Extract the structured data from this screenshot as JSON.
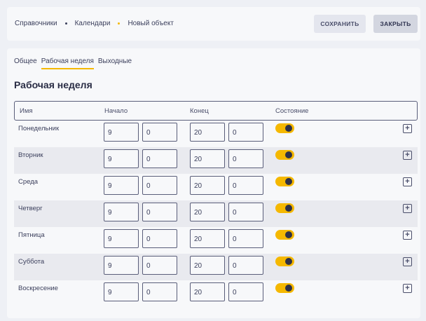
{
  "breadcrumb": {
    "items": [
      "Справочники",
      "Календари",
      "Новый объект"
    ],
    "sep_colors": [
      "#3b3f5c",
      "#f5b800"
    ]
  },
  "toolbar": {
    "save_label": "СОХРАНИТЬ",
    "close_label": "ЗАКРЫТЬ"
  },
  "tabs": [
    {
      "label": "Общее"
    },
    {
      "label": "Рабочая неделя",
      "active": true
    },
    {
      "label": "Выходные"
    }
  ],
  "section_title": "Рабочая неделя",
  "table": {
    "headers": [
      "Имя",
      "Начало",
      "Конец",
      "Состояние"
    ],
    "rows": [
      {
        "name": "Понедельник",
        "start_h": "9",
        "start_m": "0",
        "end_h": "20",
        "end_m": "0",
        "enabled": true
      },
      {
        "name": "Вторник",
        "start_h": "9",
        "start_m": "0",
        "end_h": "20",
        "end_m": "0",
        "enabled": true
      },
      {
        "name": "Среда",
        "start_h": "9",
        "start_m": "0",
        "end_h": "20",
        "end_m": "0",
        "enabled": true
      },
      {
        "name": "Четверг",
        "start_h": "9",
        "start_m": "0",
        "end_h": "20",
        "end_m": "0",
        "enabled": true
      },
      {
        "name": "Пятница",
        "start_h": "9",
        "start_m": "0",
        "end_h": "20",
        "end_m": "0",
        "enabled": true
      },
      {
        "name": "Суббота",
        "start_h": "9",
        "start_m": "0",
        "end_h": "20",
        "end_m": "0",
        "enabled": true
      },
      {
        "name": "Воскресение",
        "start_h": "9",
        "start_m": "0",
        "end_h": "20",
        "end_m": "0",
        "enabled": true
      }
    ]
  },
  "icons": {
    "add": "plus-square-icon"
  },
  "colors": {
    "accent": "#f5b800",
    "text": "#3b3f5c"
  }
}
